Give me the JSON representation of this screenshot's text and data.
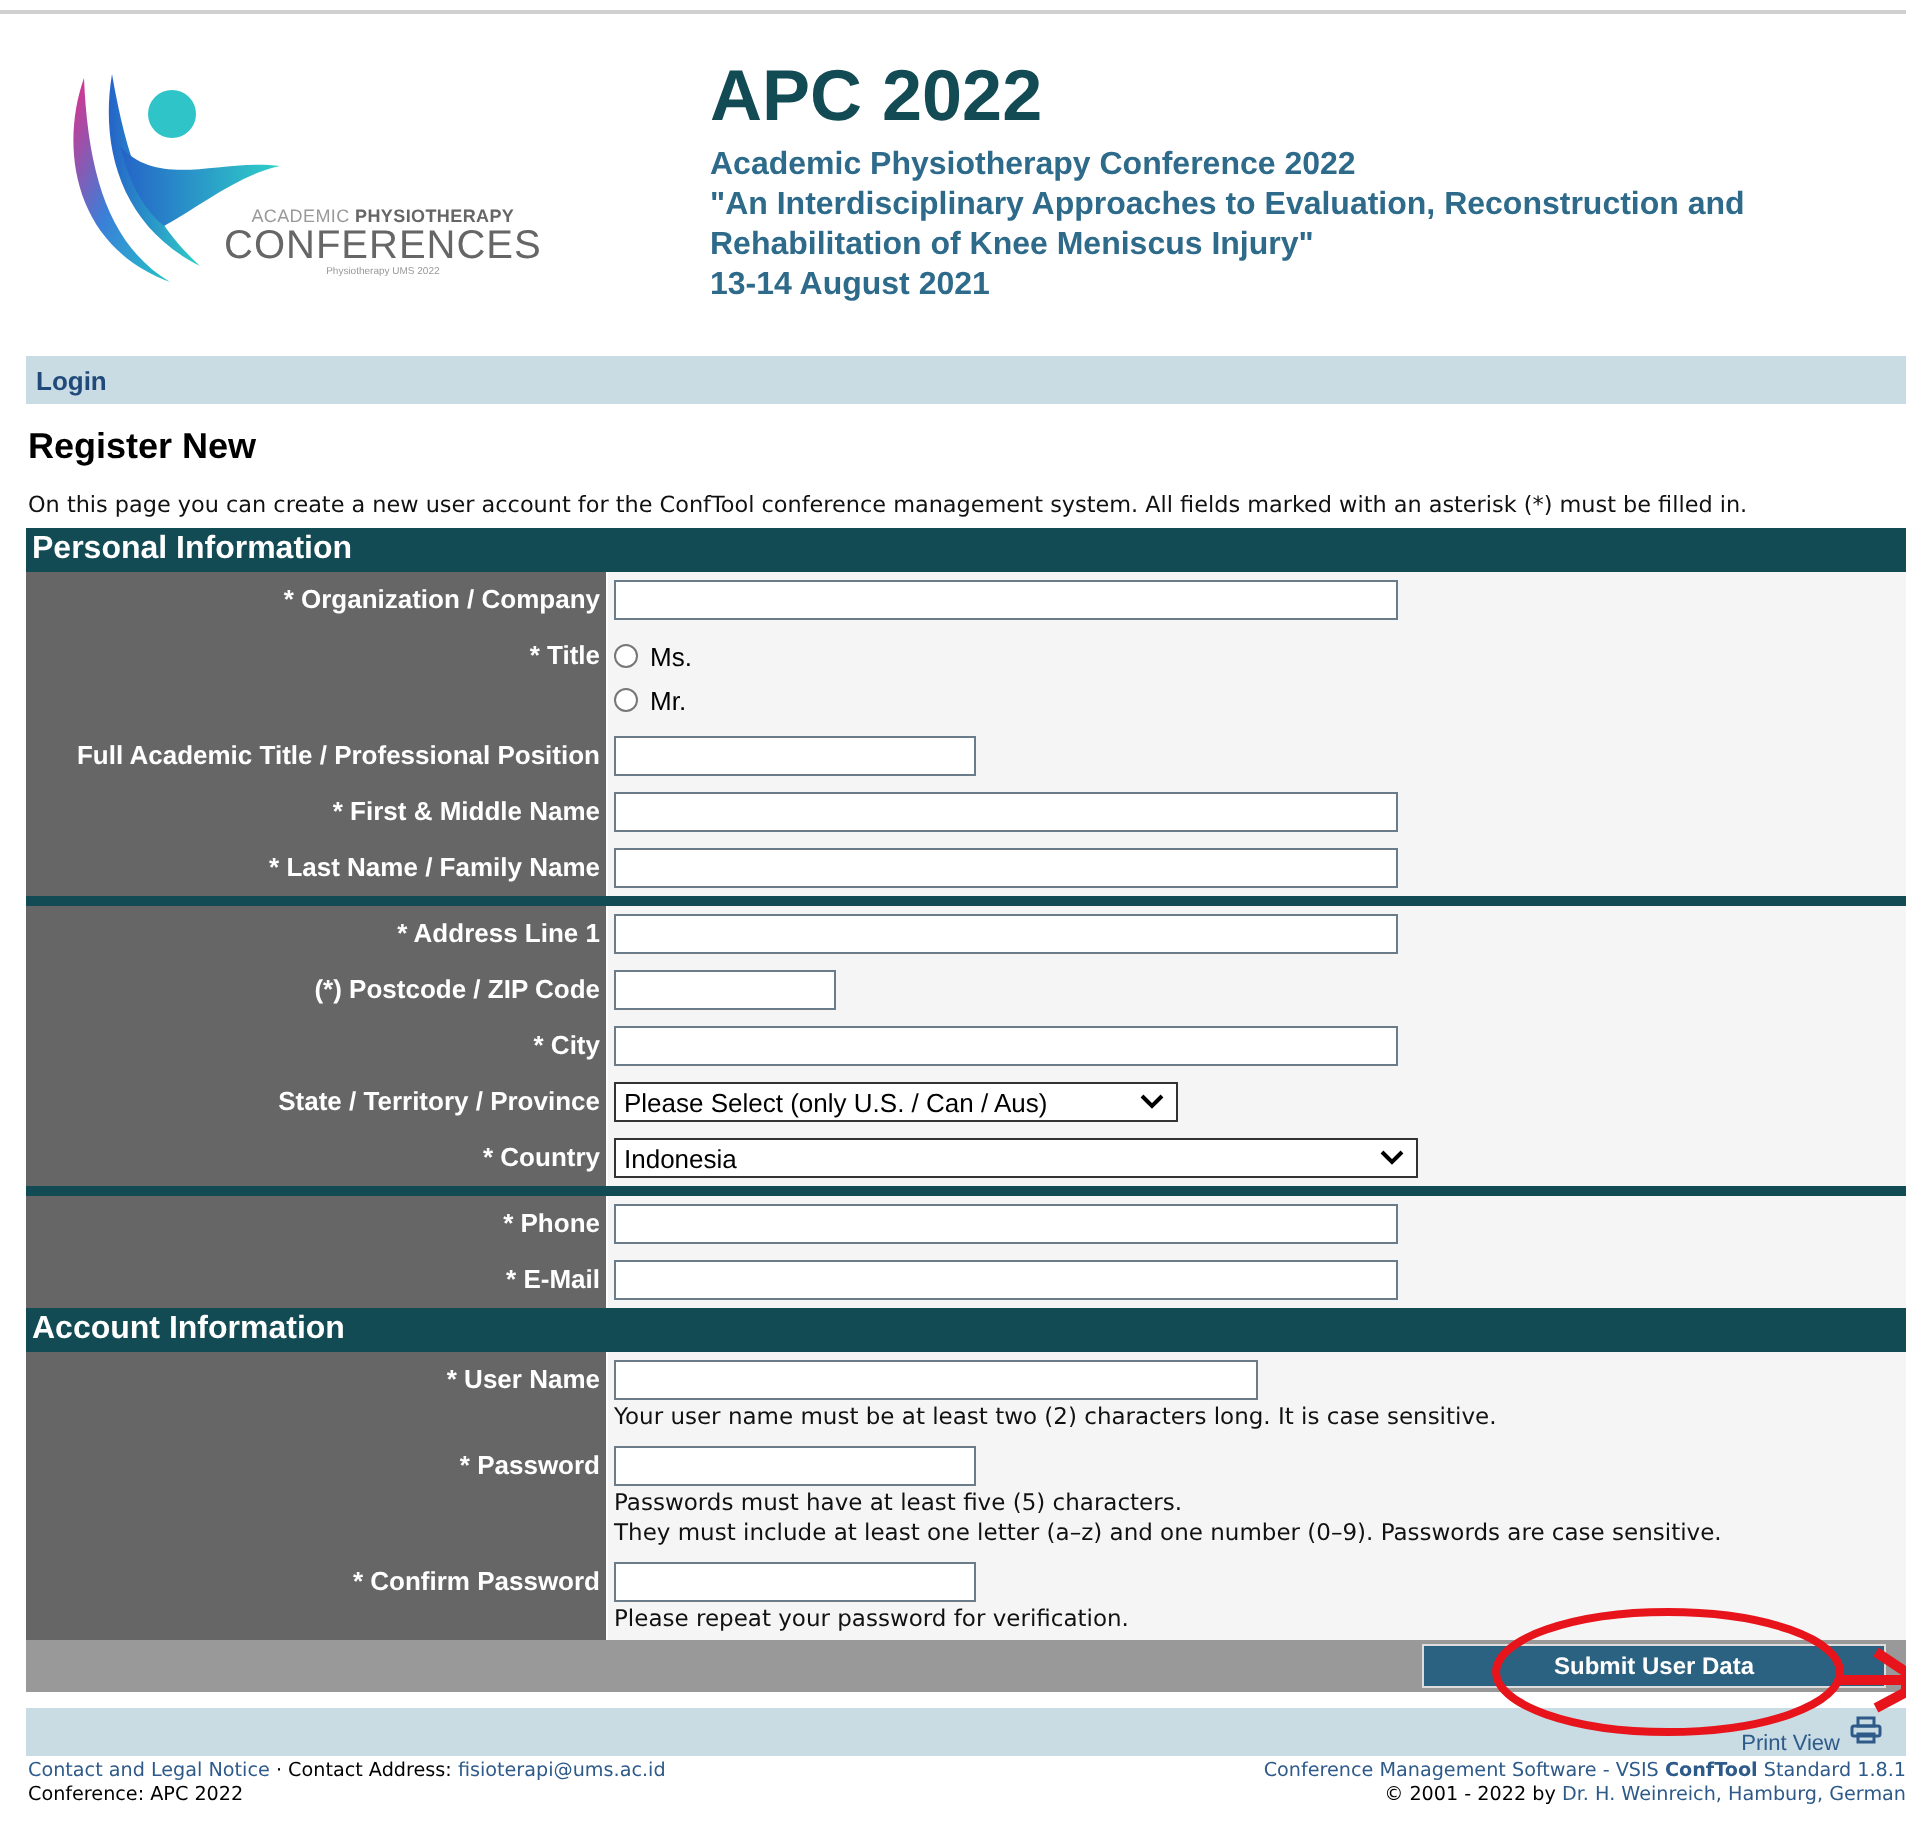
{
  "header": {
    "logo": {
      "line1a": "ACADEMIC",
      "line1b": "PHYSIOTHERAPY",
      "line2": "CONFERENCES",
      "line3": "Physiotherapy UMS 2022"
    },
    "title": "APC 2022",
    "subtitle": [
      "Academic Physiotherapy Conference 2022",
      "\"An Interdisciplinary Approaches to Evaluation, Reconstruction and",
      "Rehabilitation of Knee Meniscus Injury\"",
      "13-14 August 2021"
    ]
  },
  "nav": {
    "login": "Login"
  },
  "page_title": "Register New",
  "intro": "On this page you can create a new user account for the ConfTool conference management system. All fields marked with an asterisk (*) must be filled in.",
  "sections": [
    {
      "title": "Personal Information",
      "groups": [
        [
          {
            "label": "* Organization / Company",
            "kind": "wide"
          },
          {
            "label": "* Title",
            "kind": "radio",
            "options": [
              {
                "label": "Ms.",
                "selected": false
              },
              {
                "label": "Mr.",
                "selected": false
              }
            ]
          },
          {
            "label": "Full Academic Title / Professional Position",
            "kind": "short"
          },
          {
            "label": "* First & Middle Name",
            "kind": "wide"
          },
          {
            "label": "* Last Name / Family Name",
            "kind": "wide"
          }
        ],
        [
          {
            "label": "* Address Line 1",
            "kind": "wide"
          },
          {
            "label": "(*) Postcode / ZIP Code",
            "kind": "tiny"
          },
          {
            "label": "* City",
            "kind": "wide"
          },
          {
            "label": "State / Territory / Province",
            "kind": "dropdown",
            "value": "Please Select (only U.S. / Can / Aus)"
          },
          {
            "label": "* Country",
            "kind": "widedropdown",
            "value": "Indonesia"
          }
        ],
        [
          {
            "label": "* Phone",
            "kind": "wide"
          },
          {
            "label": "* E-Mail",
            "kind": "wide"
          }
        ]
      ]
    },
    {
      "title": "Account Information",
      "groups": [
        [
          {
            "label": "* User Name",
            "kind": "medium",
            "hints": [
              "Your user name must be at least two (2) characters long. It is case sensitive."
            ]
          },
          {
            "label": "* Password",
            "kind": "password",
            "hints": [
              "Passwords must have at least five (5) characters.",
              "They must include at least one letter (a–z) and one number (0–9). Passwords are case sensitive."
            ]
          },
          {
            "label": "* Confirm Password",
            "kind": "password",
            "hints": [
              "Please repeat your password for verification."
            ]
          }
        ]
      ]
    }
  ],
  "submit": "Submit User Data",
  "print_view": "Print View",
  "footer": {
    "legal": "Contact and Legal Notice",
    "contact_label": "· Contact Address:",
    "email": "fisioterapi@ums.ac.id",
    "conference": "Conference: APC 2022",
    "software": "Conference Management Software - VSIS **ConfTool** Standard 1.8.1",
    "copyright": "© 2001 - 2022 by",
    "author": "Dr. H. Weinreich, Hamburg, German"
  }
}
